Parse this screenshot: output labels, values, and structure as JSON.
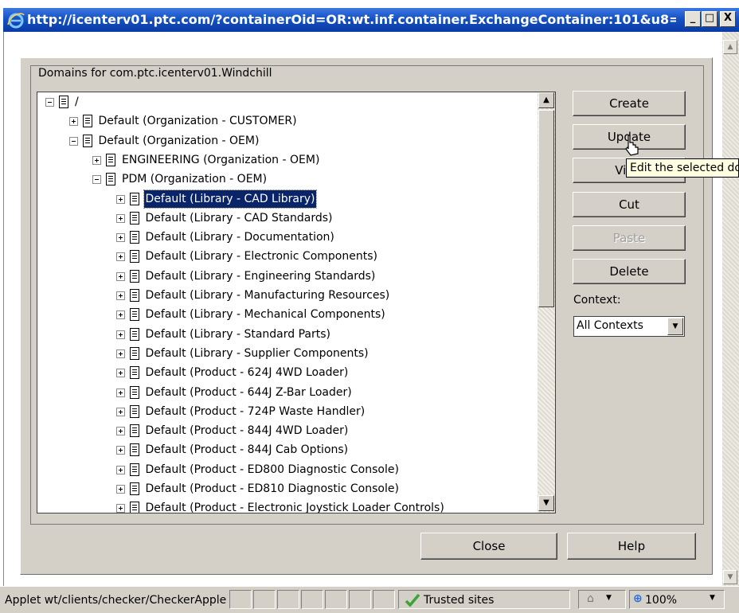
{
  "window": {
    "title": "http://icenterv01.ptc.com/?containerOid=OR:wt.inf.container.ExchangeContainer:101&u8=...",
    "minimize_label": "_",
    "maximize_label": "□",
    "close_label": "X"
  },
  "dialog": {
    "group_title": "Domains for com.ptc.icenterv01.Windchill",
    "tree": [
      {
        "label": "/",
        "depth": 0,
        "expanded": true
      },
      {
        "label": "Default (Organization - CUSTOMER)",
        "depth": 1,
        "expanded": false
      },
      {
        "label": "Default (Organization - OEM)",
        "depth": 1,
        "expanded": true
      },
      {
        "label": "ENGINEERING (Organization - OEM)",
        "depth": 2,
        "expanded": false
      },
      {
        "label": "PDM (Organization - OEM)",
        "depth": 2,
        "expanded": true
      },
      {
        "label": "Default (Library - CAD Library)",
        "depth": 3,
        "expanded": false,
        "selected": true
      },
      {
        "label": "Default (Library - CAD Standards)",
        "depth": 3,
        "expanded": false
      },
      {
        "label": "Default (Library - Documentation)",
        "depth": 3,
        "expanded": false
      },
      {
        "label": "Default (Library - Electronic Components)",
        "depth": 3,
        "expanded": false
      },
      {
        "label": "Default (Library - Engineering Standards)",
        "depth": 3,
        "expanded": false
      },
      {
        "label": "Default (Library - Manufacturing Resources)",
        "depth": 3,
        "expanded": false
      },
      {
        "label": "Default (Library - Mechanical Components)",
        "depth": 3,
        "expanded": false
      },
      {
        "label": "Default (Library - Standard Parts)",
        "depth": 3,
        "expanded": false
      },
      {
        "label": "Default (Library - Supplier Components)",
        "depth": 3,
        "expanded": false
      },
      {
        "label": "Default (Product - 624J 4WD Loader)",
        "depth": 3,
        "expanded": false
      },
      {
        "label": "Default (Product - 644J Z-Bar Loader)",
        "depth": 3,
        "expanded": false
      },
      {
        "label": "Default (Product - 724P Waste Handler)",
        "depth": 3,
        "expanded": false
      },
      {
        "label": "Default (Product - 844J 4WD Loader)",
        "depth": 3,
        "expanded": false
      },
      {
        "label": "Default (Product - 844J Cab Options)",
        "depth": 3,
        "expanded": false
      },
      {
        "label": "Default (Product - ED800 Diagnostic Console)",
        "depth": 3,
        "expanded": false
      },
      {
        "label": "Default (Product - ED810 Diagnostic Console)",
        "depth": 3,
        "expanded": false
      },
      {
        "label": "Default (Product - Electronic Joystick Loader Controls)",
        "depth": 3,
        "expanded": false
      }
    ],
    "buttons": {
      "create": "Create",
      "update": "Update",
      "view": "View",
      "cut": "Cut",
      "paste": "Paste",
      "delete": "Delete",
      "close": "Close",
      "help": "Help"
    },
    "context_label": "Context:",
    "context_value": "All Contexts",
    "tooltip": "Edit the selected domain"
  },
  "statusbar": {
    "text": "Applet wt/clients/checker/CheckerApplet started",
    "zone": "Trusted sites",
    "zoom": "100%"
  }
}
